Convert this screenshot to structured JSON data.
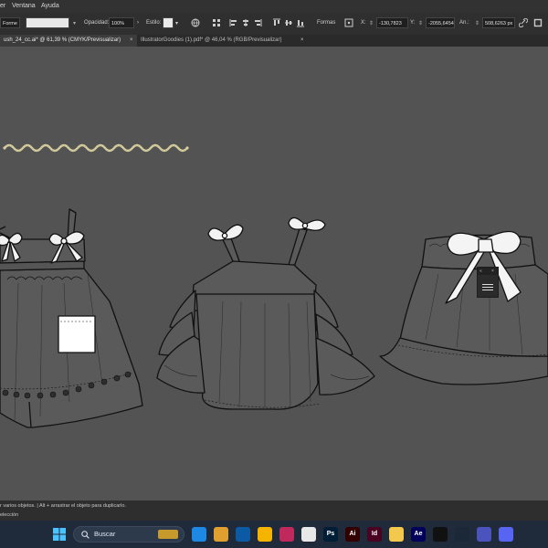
{
  "menubar": {
    "items": [
      "er",
      "Ventana",
      "Ayuda"
    ]
  },
  "control_bar": {
    "shape_label": "Forme",
    "opacity_label": "Opacidad:",
    "opacity_value": "100%",
    "style_label": "Estilo:",
    "format_label": "Formas",
    "x_label": "X:",
    "x_value": "-130,7823",
    "y_label": "Y:",
    "y_value": "-2055,6454",
    "width_label": "An.:",
    "width_value": "508,6263 px"
  },
  "tabs": [
    {
      "label": "ush_24_cc.ai* @ 61,39 % (CMYK/Previsualizar)",
      "active": true
    },
    {
      "label": "IllustratorGoodies (1).pdf* @ 46,04 % (RGB/Previsualizar)",
      "active": false
    }
  ],
  "tab_close": "×",
  "status": {
    "hint": "r varios objetos.  |  Alt + arrastrar el objeto para duplicarlo.",
    "tool": "elección"
  },
  "panel": {
    "close": "×",
    "collapse": "«"
  },
  "taskbar": {
    "search_placeholder": "Buscar",
    "apps": [
      {
        "label": "",
        "color": "#1e88e5"
      },
      {
        "label": "",
        "color": "#e0a030"
      },
      {
        "label": "",
        "color": "#0c59a4"
      },
      {
        "label": "",
        "color": "#f4b400"
      },
      {
        "label": "",
        "color": "#c0295b"
      },
      {
        "label": "",
        "color": "#e8e8e8"
      },
      {
        "label": "Ps",
        "color": "#001e36"
      },
      {
        "label": "Ai",
        "color": "#330000"
      },
      {
        "label": "Id",
        "color": "#49021f"
      },
      {
        "label": "",
        "color": "#f2c94c"
      },
      {
        "label": "Ae",
        "color": "#00005b"
      },
      {
        "label": "",
        "color": "#111111"
      },
      {
        "label": "",
        "color": "#1b2838"
      },
      {
        "label": "",
        "color": "#4b53bc"
      },
      {
        "label": "",
        "color": "#5865f2"
      }
    ]
  },
  "colors": {
    "canvas": "#535353",
    "chrome": "#2f2f2f",
    "taskbar": "#1f2a3a",
    "garment_fill": "#5a5a5a",
    "trim": "#d8cfa0"
  }
}
